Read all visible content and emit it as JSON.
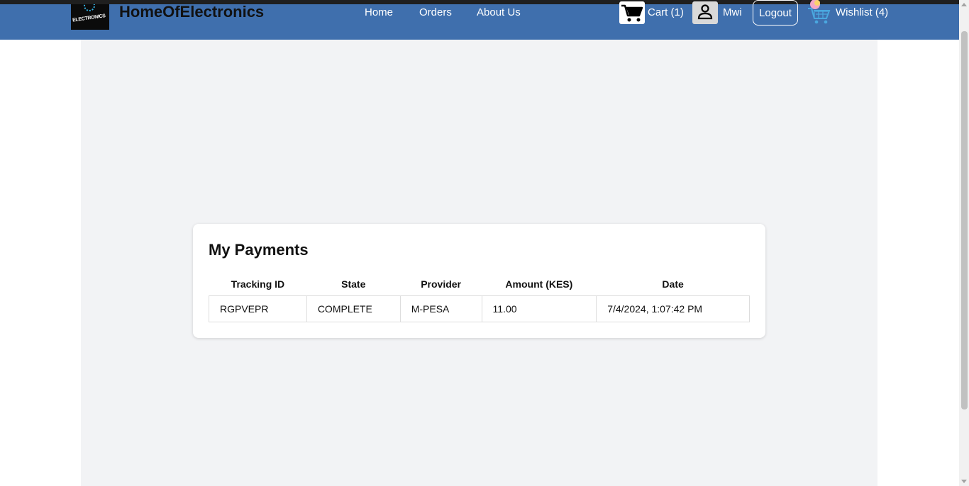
{
  "header": {
    "brand": "HomeOfElectronics",
    "logo_text": "ELECTRONICS",
    "nav": [
      {
        "label": "Home"
      },
      {
        "label": "Orders"
      },
      {
        "label": "About Us"
      }
    ],
    "cart_label": "Cart (1)",
    "user_name": "Mwi",
    "logout_label": "Logout",
    "wishlist_label": "Wishlist (4)",
    "colors": {
      "navbar": "#3f6fad",
      "content_bg": "#f2f3f5"
    }
  },
  "payments": {
    "title": "My Payments",
    "columns": [
      "Tracking ID",
      "State",
      "Provider",
      "Amount (KES)",
      "Date"
    ],
    "rows": [
      [
        "RGPVEPR",
        "COMPLETE",
        "M-PESA",
        "11.00",
        "7/4/2024, 1:07:42 PM"
      ]
    ]
  }
}
